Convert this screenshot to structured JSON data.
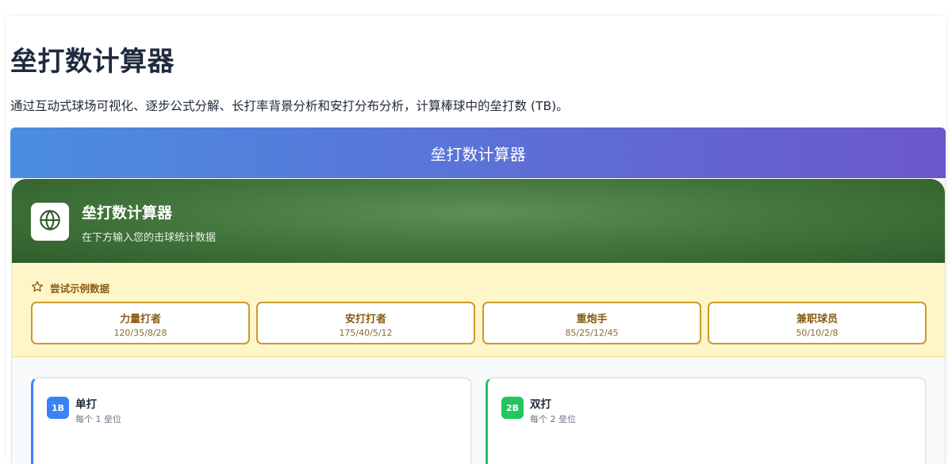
{
  "page": {
    "title": "垒打数计算器",
    "description": "通过互动式球场可视化、逐步公式分解、长打率背景分析和安打分布分析，计算棒球中的垒打数 (TB)。"
  },
  "banner": {
    "title": "垒打数计算器"
  },
  "calculator": {
    "icon": "globe-icon",
    "title": "垒打数计算器",
    "subtitle": "在下方输入您的击球统计数据"
  },
  "examples": {
    "heading": "尝试示例数据",
    "icon": "star-icon",
    "items": [
      {
        "name": "力量打者",
        "values": "120/35/8/28"
      },
      {
        "name": "安打打者",
        "values": "175/40/5/12"
      },
      {
        "name": "重炮手",
        "values": "85/25/12/45"
      },
      {
        "name": "兼职球员",
        "values": "50/10/2/8"
      }
    ]
  },
  "hits": [
    {
      "badge": "1B",
      "name": "单打",
      "desc": "每个 1 垒位"
    },
    {
      "badge": "2B",
      "name": "双打",
      "desc": "每个 2 垒位"
    }
  ],
  "colors": {
    "banner_start": "#4a8ee0",
    "banner_end": "#6b57cc",
    "header_green": "#44783e",
    "examples_bg": "#fef6c8",
    "examples_border": "#c99a2e",
    "single_accent": "#3b82f6",
    "double_accent": "#22c55e"
  }
}
